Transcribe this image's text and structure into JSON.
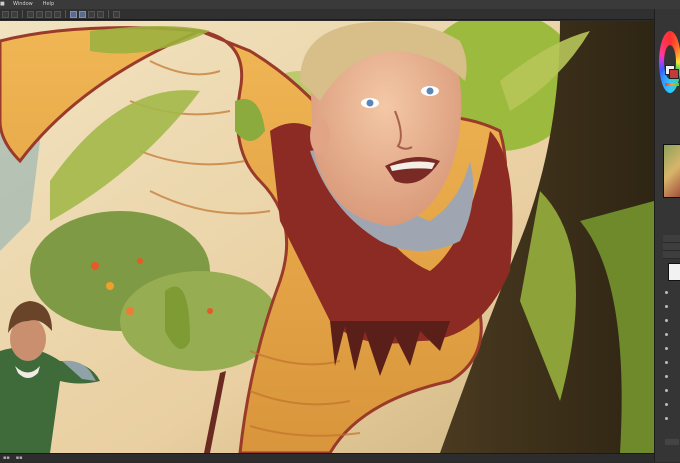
{
  "menubar": {
    "items": [
      {
        "label": "Window"
      },
      {
        "label": "Help"
      }
    ]
  },
  "toolbar": {
    "tools": [
      "undo-icon",
      "redo-icon",
      "clear-icon",
      "transform-icon",
      "fill-icon",
      "brush-icon",
      "eraser-icon",
      "selection-icon",
      "lasso-icon",
      "snap-icon",
      "ruler-icon"
    ]
  },
  "colors": {
    "ui_dark": "#2b2b2b",
    "ui_panel": "#353535",
    "accent_selected": "#5a6b8c",
    "main_color": "#f2f2f2",
    "sub_color": "#c23b3b"
  },
  "canvas": {
    "subject": "digital painting",
    "elements": [
      "boy-in-tree",
      "second-figure",
      "tree-branches",
      "leaves",
      "flower-bushes"
    ]
  }
}
